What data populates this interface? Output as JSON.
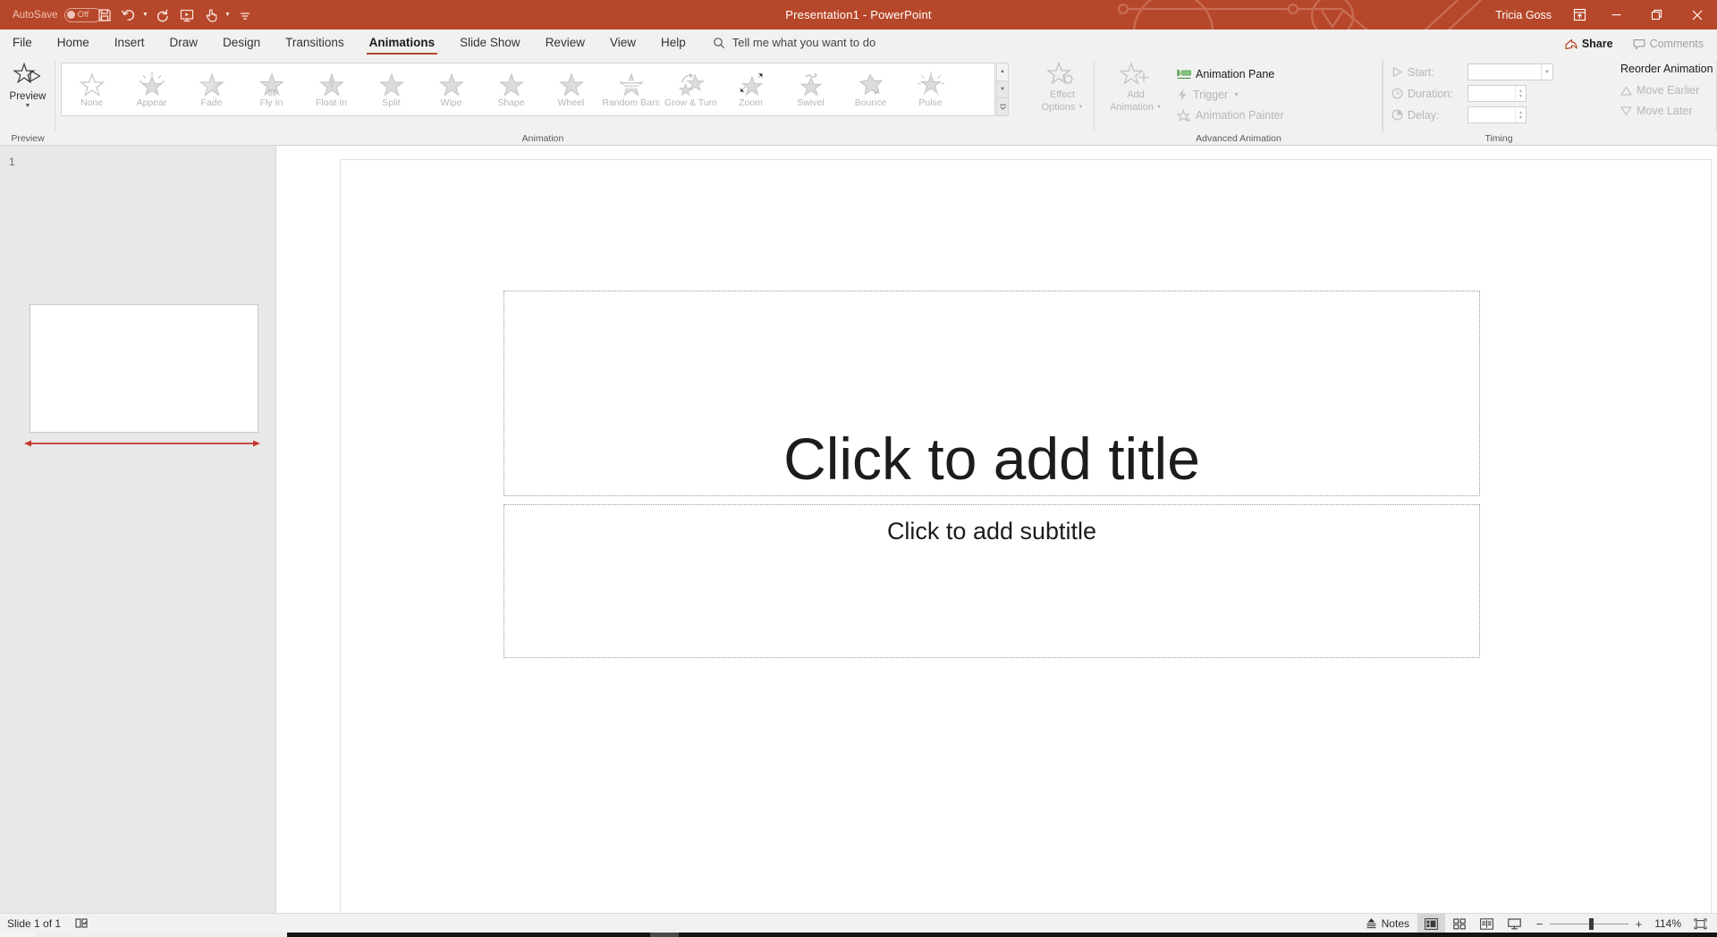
{
  "titlebar": {
    "autosave_label": "AutoSave",
    "autosave_state": "Off",
    "title": "Presentation1  -  PowerPoint",
    "account_name": "Tricia Goss",
    "qat": [
      {
        "name": "save-icon",
        "label": "Save"
      },
      {
        "name": "undo-icon",
        "label": "Undo"
      },
      {
        "name": "redo-icon",
        "label": "Redo"
      },
      {
        "name": "start-from-beginning-icon",
        "label": "Start From Beginning"
      },
      {
        "name": "touch-mouse-mode-icon",
        "label": "Touch/Mouse Mode"
      },
      {
        "name": "customize-quick-access-toolbar-icon",
        "label": "Customize Quick Access Toolbar"
      }
    ],
    "window_buttons": [
      {
        "name": "ribbon-display-options-button",
        "label": "Ribbon Display Options"
      },
      {
        "name": "minimize-button",
        "label": "Minimize"
      },
      {
        "name": "restore-button",
        "label": "Restore Down"
      },
      {
        "name": "close-button",
        "label": "Close"
      }
    ]
  },
  "tabs": [
    {
      "label": "File",
      "active": false
    },
    {
      "label": "Home",
      "active": false
    },
    {
      "label": "Insert",
      "active": false
    },
    {
      "label": "Draw",
      "active": false
    },
    {
      "label": "Design",
      "active": false
    },
    {
      "label": "Transitions",
      "active": false
    },
    {
      "label": "Animations",
      "active": true
    },
    {
      "label": "Slide Show",
      "active": false
    },
    {
      "label": "Review",
      "active": false
    },
    {
      "label": "View",
      "active": false
    },
    {
      "label": "Help",
      "active": false
    }
  ],
  "tellme": {
    "placeholder": "Tell me what you want to do",
    "icon": "search-icon"
  },
  "tabstrip_right": {
    "share_label": "Share",
    "comments_label": "Comments"
  },
  "ribbon": {
    "groups": [
      {
        "key": "preview",
        "label": "Preview"
      },
      {
        "key": "animation",
        "label": "Animation"
      },
      {
        "key": "advanced",
        "label": "Advanced Animation"
      },
      {
        "key": "timing",
        "label": "Timing"
      }
    ],
    "preview": {
      "button_label": "Preview",
      "icon": "preview-star-icon"
    },
    "animation_gallery": {
      "items": [
        {
          "label": "None",
          "icon": "star-outline-icon"
        },
        {
          "label": "Appear",
          "icon": "star-appear-icon"
        },
        {
          "label": "Fade",
          "icon": "star-fade-icon"
        },
        {
          "label": "Fly In",
          "icon": "star-fly-in-icon"
        },
        {
          "label": "Float In",
          "icon": "star-float-in-icon"
        },
        {
          "label": "Split",
          "icon": "star-split-icon"
        },
        {
          "label": "Wipe",
          "icon": "star-wipe-icon"
        },
        {
          "label": "Shape",
          "icon": "star-shape-icon"
        },
        {
          "label": "Wheel",
          "icon": "star-wheel-icon"
        },
        {
          "label": "Random Bars",
          "icon": "star-random-bars-icon"
        },
        {
          "label": "Grow & Turn",
          "icon": "star-grow-turn-icon"
        },
        {
          "label": "Zoom",
          "icon": "star-zoom-icon"
        },
        {
          "label": "Swivel",
          "icon": "star-swivel-icon"
        },
        {
          "label": "Bounce",
          "icon": "star-bounce-icon"
        },
        {
          "label": "Pulse",
          "icon": "star-pulse-icon"
        }
      ],
      "scroll_up": "▲",
      "scroll_down": "▼",
      "more": "▼"
    },
    "effect_options": {
      "label_line1": "Effect",
      "label_line2": "Options",
      "icon": "effect-options-icon",
      "enabled": false
    },
    "advanced_animation": {
      "add_animation_line1": "Add",
      "add_animation_line2": "Animation",
      "add_animation_icon": "add-animation-icon",
      "animation_pane_label": "Animation Pane",
      "animation_pane_icon": "animation-pane-icon",
      "trigger_label": "Trigger",
      "trigger_icon": "trigger-lightning-icon",
      "animation_painter_label": "Animation Painter",
      "animation_painter_icon": "animation-painter-icon"
    },
    "timing": {
      "start_label": "Start:",
      "start_value": "",
      "start_icon": "play-triangle-icon",
      "duration_label": "Duration:",
      "duration_value": "",
      "duration_icon": "clock-icon",
      "delay_label": "Delay:",
      "delay_value": "",
      "delay_icon": "clock-delay-icon"
    },
    "reorder": {
      "title": "Reorder Animation",
      "move_earlier_label": "Move Earlier",
      "move_earlier_icon": "triangle-up-icon",
      "move_later_label": "Move Later",
      "move_later_icon": "triangle-down-icon"
    }
  },
  "thumbnail_pane": {
    "slide_number": "1",
    "annotation_icon": "red-double-arrow-annotation"
  },
  "slide": {
    "title_placeholder": "Click to add title",
    "subtitle_placeholder": "Click to add subtitle"
  },
  "statusbar": {
    "slide_count": "Slide 1 of 1",
    "accessibility_icon": "accessibility-checker-icon",
    "notes_label": "Notes",
    "notes_icon": "notes-icon",
    "views": [
      {
        "name": "normal-view-button",
        "label": "Normal",
        "icon": "normal-view-icon",
        "active": true
      },
      {
        "name": "slide-sorter-button",
        "label": "Slide Sorter",
        "icon": "slide-sorter-icon",
        "active": false
      },
      {
        "name": "reading-view-button",
        "label": "Reading View",
        "icon": "reading-view-icon",
        "active": false
      },
      {
        "name": "slideshow-button",
        "label": "Slide Show",
        "icon": "slideshow-icon",
        "active": false
      }
    ],
    "zoom_out": "−",
    "zoom_in": "+",
    "zoom_value": "114%",
    "fit_slide_icon": "fit-slide-icon"
  },
  "colors": {
    "brand": "#b7472a",
    "ribbon_bg": "#f1f1f1",
    "thumb_pane_bg": "#e8e8e8",
    "disabled_text": "#b6b6b6",
    "annotation_red": "#c0392b"
  }
}
